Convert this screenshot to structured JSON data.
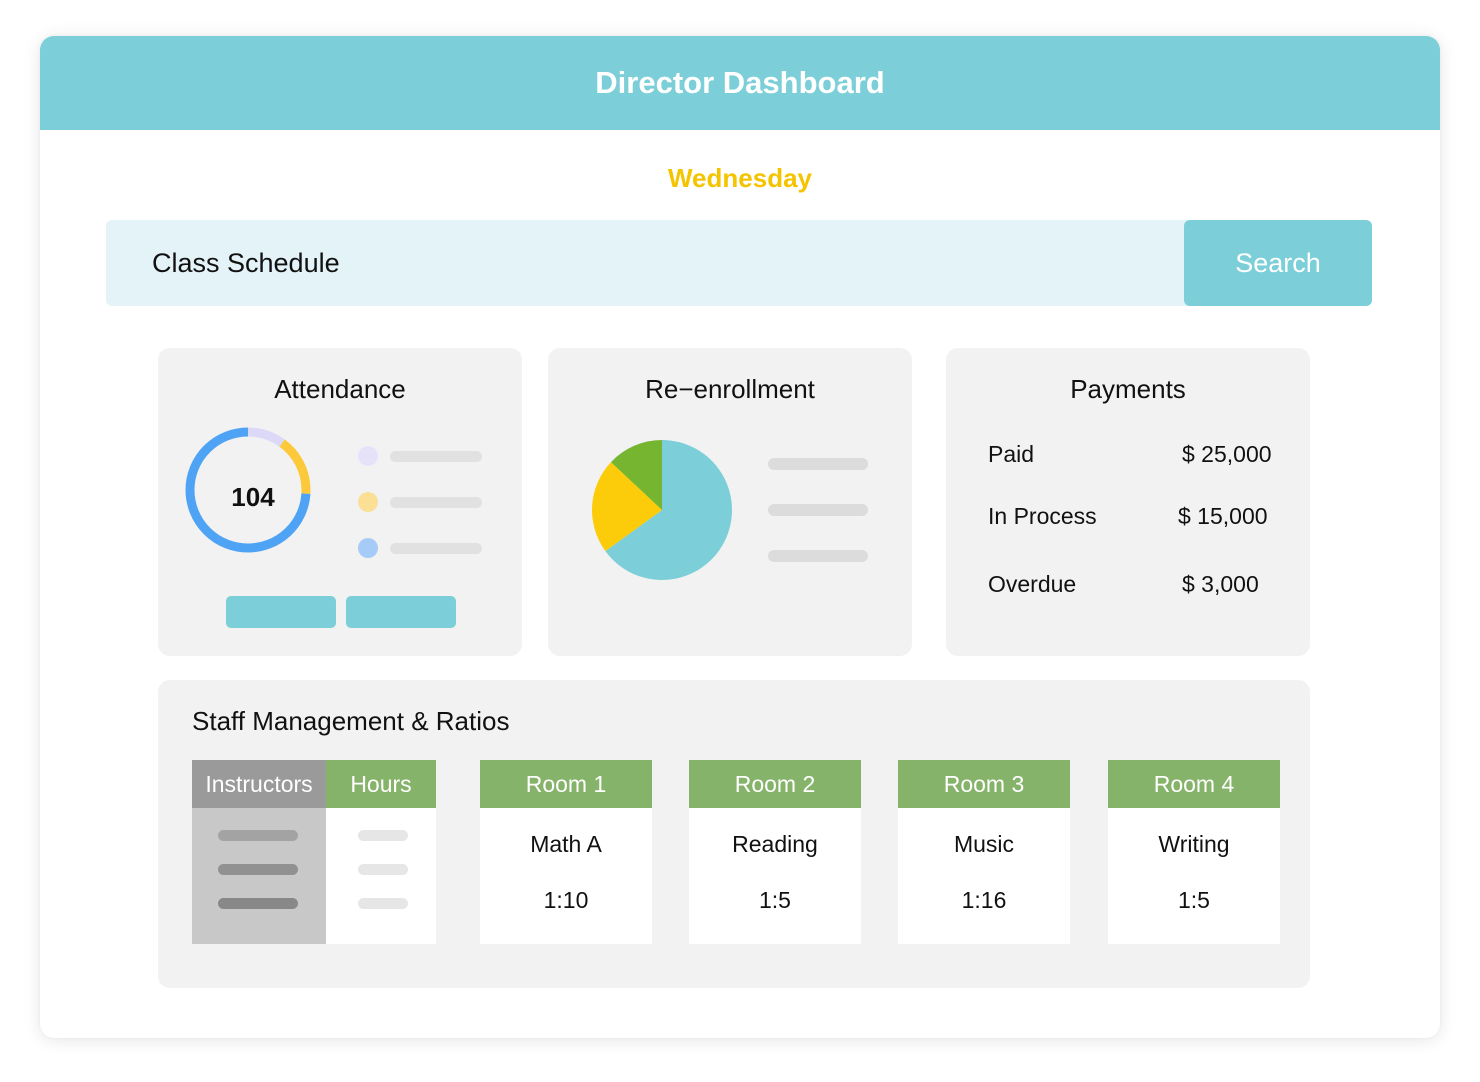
{
  "title": "Director Dashboard",
  "day": "Wednesday",
  "search": {
    "label": "Class Schedule",
    "button": "Search"
  },
  "attendance": {
    "title": "Attendance",
    "count": "104",
    "ring_segments": [
      {
        "fraction": 0.1,
        "color": "#dcd8f8"
      },
      {
        "fraction": 0.16,
        "color": "#fbc93a"
      },
      {
        "fraction": 0.74,
        "color": "#4fa3f5"
      }
    ],
    "legend_colors": [
      "#e6e2f9",
      "#fadf95",
      "#a6cbf7"
    ]
  },
  "reenrollment": {
    "title": "Re−enrollment",
    "slices": [
      {
        "fraction": 0.65,
        "color": "#7ccfd8"
      },
      {
        "fraction": 0.22,
        "color": "#fccb0a"
      },
      {
        "fraction": 0.13,
        "color": "#76b52f"
      }
    ]
  },
  "payments": {
    "title": "Payments",
    "rows": [
      {
        "label": "Paid",
        "value": "$ 25,000"
      },
      {
        "label": "In Process",
        "value": "$ 15,000"
      },
      {
        "label": "Overdue",
        "value": "$ 3,000"
      }
    ]
  },
  "staff": {
    "title": "Staff Management & Ratios",
    "instructors_header": "Instructors",
    "hours_header": "Hours",
    "rooms": [
      {
        "name": "Room 1",
        "subject": "Math A",
        "ratio": "1:10"
      },
      {
        "name": "Room 2",
        "subject": "Reading",
        "ratio": "1:5"
      },
      {
        "name": "Room 3",
        "subject": "Music",
        "ratio": "1:16"
      },
      {
        "name": "Room 4",
        "subject": "Writing",
        "ratio": "1:5"
      }
    ]
  },
  "colors": {
    "accent": "#7ccfd8",
    "day": "#f5c400",
    "room_header": "#86b36a",
    "instructor_header": "#9a9a9a"
  }
}
